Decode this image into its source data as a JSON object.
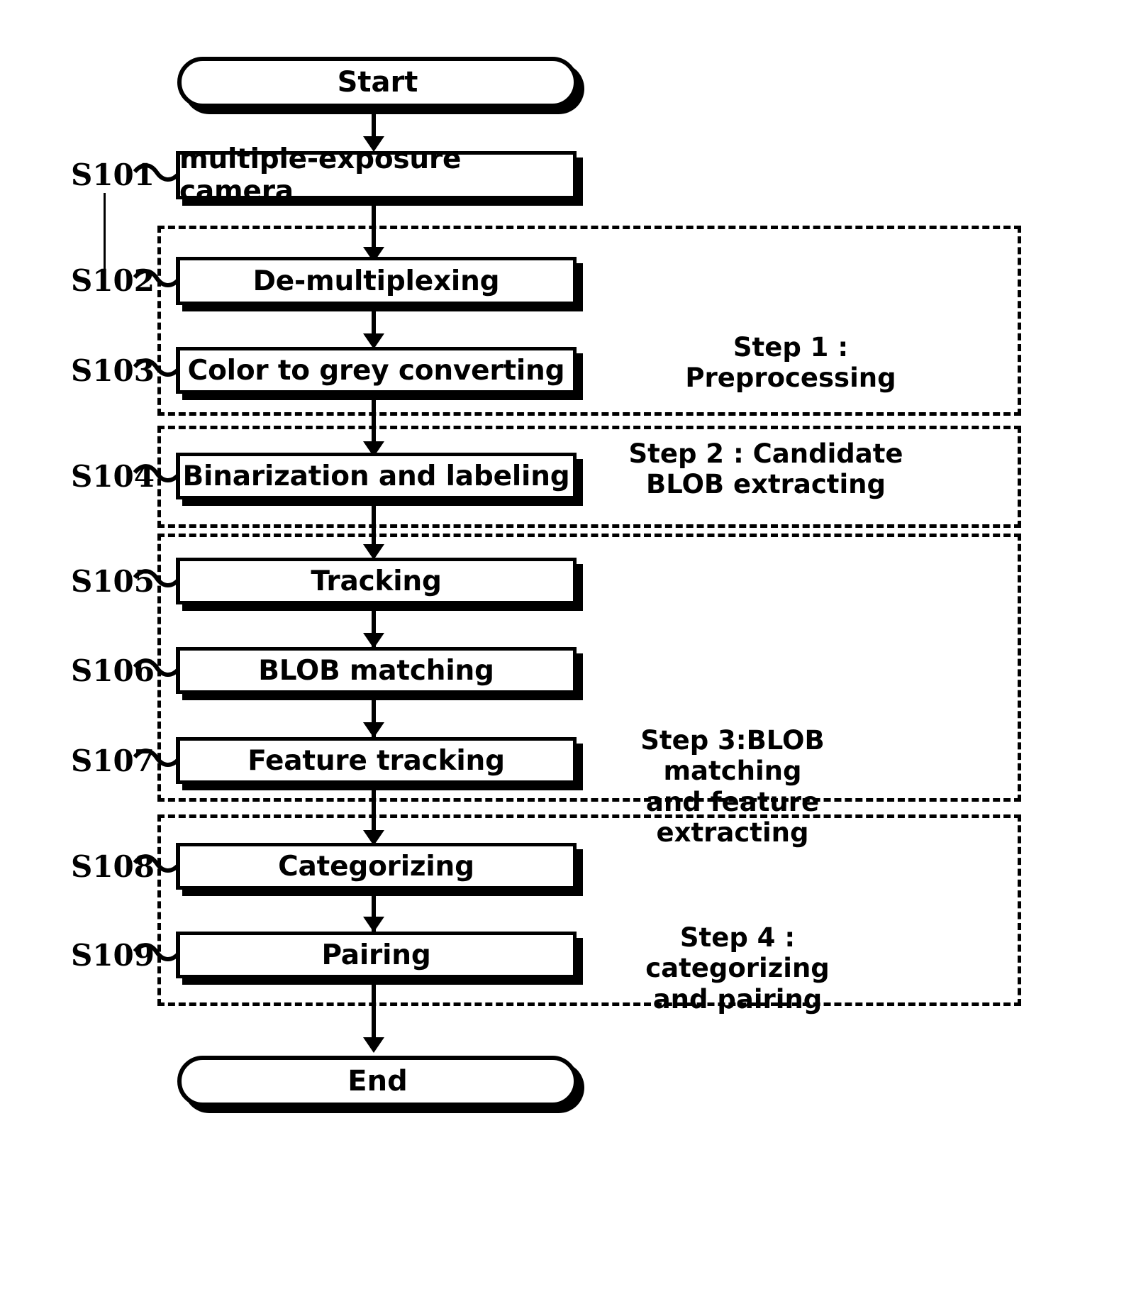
{
  "diagram": {
    "type": "flowchart",
    "title_terminal_start": "Start",
    "title_terminal_end": "End",
    "colors": {
      "stroke": "#000000",
      "fill": "#ffffff"
    },
    "nodes": [
      {
        "ref": "S101",
        "label": "multiple-exposure camera"
      },
      {
        "ref": "S102",
        "label": "De-multiplexing"
      },
      {
        "ref": "S103",
        "label": "Color to grey converting"
      },
      {
        "ref": "S104",
        "label": "Binarization and labeling"
      },
      {
        "ref": "S105",
        "label": "Tracking"
      },
      {
        "ref": "S106",
        "label": "BLOB matching"
      },
      {
        "ref": "S107",
        "label": "Feature tracking"
      },
      {
        "ref": "S108",
        "label": "Categorizing"
      },
      {
        "ref": "S109",
        "label": "Pairing"
      }
    ],
    "groups": [
      {
        "id": "step1",
        "line1": "Step 1 :",
        "line2": "Preprocessing"
      },
      {
        "id": "step2",
        "line1": "Step  2 : Candidate",
        "line2": "BLOB extracting"
      },
      {
        "id": "step3",
        "line1": "Step 3:BLOB matching",
        "line2": "and feature extracting"
      },
      {
        "id": "step4",
        "line1": "Step 4 : categorizing",
        "line2": "and pairing"
      }
    ]
  }
}
